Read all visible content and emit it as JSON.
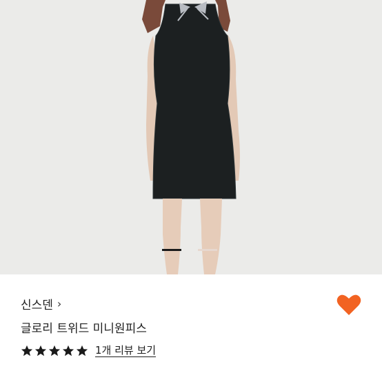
{
  "product": {
    "brand": "신스덴",
    "brand_chevron": "›",
    "name": "글로리 트위드 미니원피스",
    "review_link": "1개 리뷰 보기",
    "rating": 5,
    "rating_max": 5,
    "favorite": true
  },
  "carousel": {
    "active_index": 0,
    "total": 2
  },
  "colors": {
    "heart": "#f26322",
    "star": "#1a1a1a",
    "hero_bg": "#ebebe9"
  },
  "icons": {
    "brand_chevron": "chevron-right-icon",
    "favorite": "heart-icon",
    "rating": "star-icon"
  }
}
